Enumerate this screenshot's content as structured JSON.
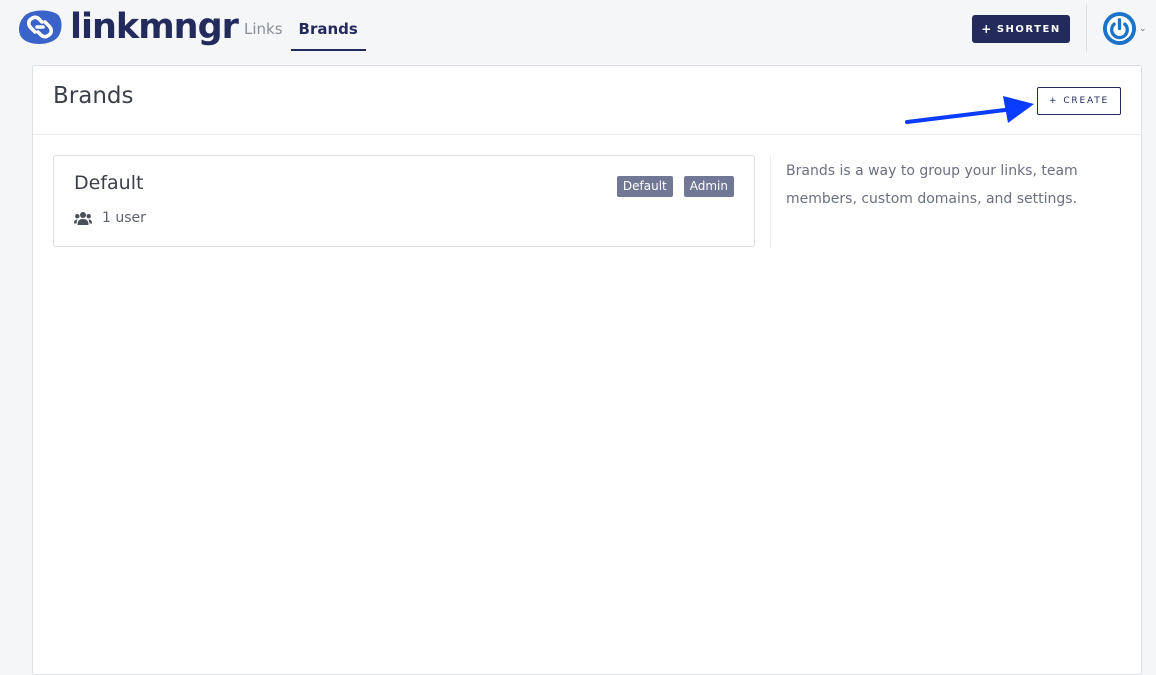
{
  "app": {
    "logo_text": "linkmngr",
    "logo_icon": "chain-link-icon"
  },
  "nav": {
    "tabs": [
      {
        "label": "Links",
        "active": false
      },
      {
        "label": "Brands",
        "active": true
      }
    ]
  },
  "header": {
    "shorten_icon": "+",
    "shorten_label": "SHORTEN",
    "avatar_icon": "power-icon",
    "caret_icon": "⌄"
  },
  "page": {
    "title": "Brands",
    "create_icon": "+",
    "create_label": "CREATE",
    "sidebar_text": "Brands is a way to group your links, team members, custom domains, and settings."
  },
  "brands": [
    {
      "name": "Default",
      "badges": [
        "Default",
        "Admin"
      ],
      "members_icon": "users-icon",
      "members_text": "1 user"
    }
  ],
  "colors": {
    "brand": "#232a5c",
    "badge": "#717896",
    "annotation_arrow": "#0a3cff",
    "avatar_ring": "#1a73c8"
  }
}
